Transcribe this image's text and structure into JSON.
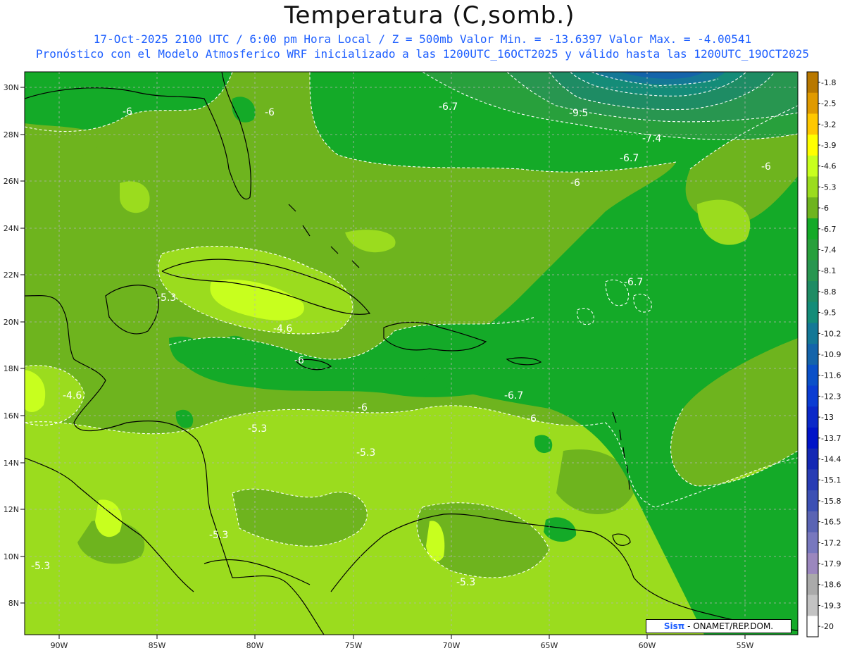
{
  "header": {
    "title": "Temperatura (C,somb.)",
    "line1": "17-Oct-2025  2100 UTC / 6:00 pm Hora Local / Z = 500mb  Valor Min. = -13.6397  Valor Max. = -4.00541",
    "line2": "Pronóstico con el Modelo Atmosferico WRF inicializado a las 1200UTC_16OCT2025 y válido hasta las  1200UTC_19OCT2025"
  },
  "axes": {
    "lon_labels": [
      "90W",
      "85W",
      "80W",
      "75W",
      "70W",
      "65W",
      "60W",
      "55W"
    ],
    "lat_labels": [
      "30N",
      "28N",
      "26N",
      "24N",
      "22N",
      "20N",
      "18N",
      "16N",
      "14N",
      "12N",
      "10N",
      "8N"
    ]
  },
  "colorbar": {
    "levels": [
      "-1.8",
      "-2.5",
      "-3.2",
      "-3.9",
      "-4.6",
      "-5.3",
      "-6",
      "-6.7",
      "-7.4",
      "-8.1",
      "-8.8",
      "-9.5",
      "-10.2",
      "-10.9",
      "-11.6",
      "-12.3",
      "-13",
      "-13.7",
      "-14.4",
      "-15.1",
      "-15.8",
      "-16.5",
      "-17.2",
      "-17.9",
      "-18.6",
      "-19.3",
      "-20"
    ],
    "colors": [
      "#b87800",
      "#e09a00",
      "#ffc800",
      "#ffff00",
      "#c8ff1e",
      "#9bdc1e",
      "#6eb41e",
      "#14aa28",
      "#28a03c",
      "#289650",
      "#1e8c64",
      "#148c78",
      "#147896",
      "#1464aa",
      "#0a50c8",
      "#0a3cd2",
      "#0a28c8",
      "#0014c8",
      "#1428b4",
      "#283cb4",
      "#3c50b4",
      "#5a64b4",
      "#7878be",
      "#9b87be",
      "#aaaaaa",
      "#c3c3c3",
      "#ffffff"
    ]
  },
  "contour_labels": [
    "-6",
    "-6",
    "-6.7",
    "-9.5",
    "-7.4",
    "-6.7",
    "-6",
    "-6",
    "-6.7",
    "-5.3",
    "-4.6",
    "-6",
    "-4.6",
    "-6",
    "-6.7",
    "-6",
    "-5.3",
    "-5.3",
    "-5.3",
    "-5.3",
    "-5.3"
  ],
  "credit": {
    "brand": "Sisπ",
    "org": "- ONAMET/REP.DOM."
  }
}
